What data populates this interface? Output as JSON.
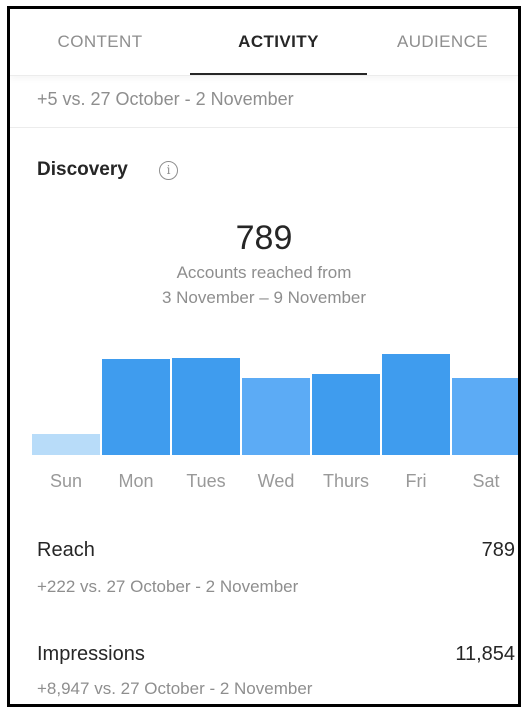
{
  "tabs": [
    {
      "label": "CONTENT",
      "active": false
    },
    {
      "label": "ACTIVITY",
      "active": true
    },
    {
      "label": "AUDIENCE",
      "active": false
    }
  ],
  "top_comparison": "+5 vs. 27 October - 2 November",
  "discovery": {
    "title": "Discovery",
    "info_icon": "info-icon",
    "accounts_reached": "789",
    "subtitle_line1": "Accounts reached from",
    "subtitle_line2": "3 November – 9 November"
  },
  "chart_data": {
    "type": "bar",
    "categories": [
      "Sun",
      "Mon",
      "Tues",
      "Wed",
      "Thurs",
      "Fri",
      "Sat"
    ],
    "values": [
      21,
      96,
      97,
      77,
      81,
      101,
      77
    ],
    "bar_colors": [
      "#b8dcf9",
      "#3f9cee",
      "#3f9cee",
      "#5cabf5",
      "#3f9cee",
      "#3f9cee",
      "#5cabf5"
    ],
    "ylim": [
      0,
      101
    ],
    "title": "",
    "xlabel": "",
    "ylabel": ""
  },
  "metrics": [
    {
      "label": "Reach",
      "value": "789",
      "comparison": "+222 vs. 27 October - 2 November"
    },
    {
      "label": "Impressions",
      "value": "11,854",
      "comparison": "+8,947 vs. 27 October - 2 November"
    }
  ],
  "colors": {
    "text_primary": "#262626",
    "text_secondary": "#8e8e8e",
    "bar_primary": "#3f9cee",
    "bar_light": "#b8dcf9"
  }
}
